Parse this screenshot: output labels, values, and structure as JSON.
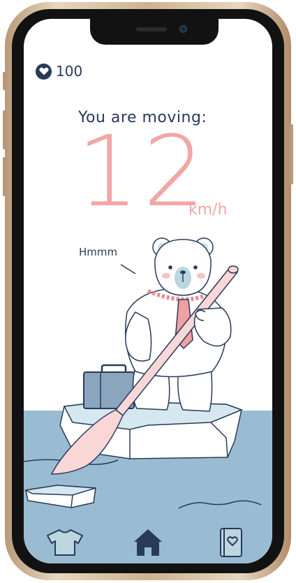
{
  "status": {
    "hearts_count": "100",
    "heart_icon": "heart-icon"
  },
  "speed": {
    "label": "You are moving:",
    "value": "12",
    "unit": "km/h"
  },
  "bear": {
    "speech": "Hmmm"
  },
  "nav": {
    "items": [
      {
        "icon": "tshirt-icon",
        "active": false
      },
      {
        "icon": "home-icon",
        "active": true
      },
      {
        "icon": "journal-heart-icon",
        "active": false
      }
    ]
  },
  "colors": {
    "navy": "#273a5a",
    "pink": "#f2a6a6",
    "water": "#9abcd2",
    "ice": "#ffffff"
  }
}
